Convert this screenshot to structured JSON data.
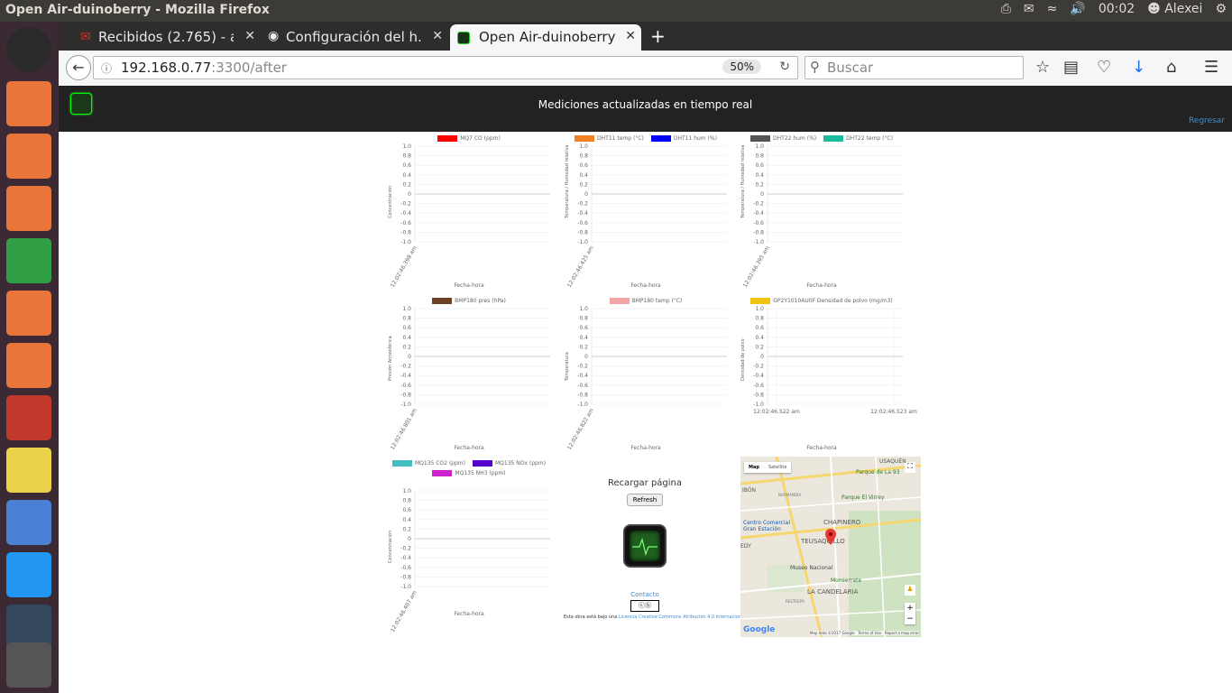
{
  "window": {
    "title": "Open Air-duinoberry - Mozilla Firefox"
  },
  "panel": {
    "time": "00:02",
    "user": "Alexei"
  },
  "tabs": [
    {
      "label": "Recibidos (2.765) - a...",
      "icon": "gmail-icon"
    },
    {
      "label": "Configuración del h...",
      "icon": "github-icon"
    },
    {
      "label": "Open Air-duinoberry",
      "icon": "duinoberry-icon"
    }
  ],
  "urlbar": {
    "host": "192.168.0.77",
    "path": ":3300/after",
    "zoom": "50%"
  },
  "searchbar": {
    "placeholder": "Buscar"
  },
  "app": {
    "header_title": "Mediciones actualizadas en tiempo real",
    "back_link": "Regresar"
  },
  "chart_data": [
    {
      "type": "line",
      "series": [
        {
          "name": "MQ7 CO (ppm)",
          "color": "#ff0000",
          "values": []
        }
      ],
      "xlabel": "Fecha-hora",
      "ylabel": "Concentración",
      "ylim": [
        -1,
        1
      ],
      "yticks": [
        "1.0",
        "0.8",
        "0.6",
        "0.4",
        "0.2",
        "0",
        "-0.2",
        "-0.4",
        "-0.6",
        "-0.8",
        "-1.0"
      ],
      "x": [
        "12:02:46.398 am"
      ]
    },
    {
      "type": "line",
      "series": [
        {
          "name": "DHT11 temp (°C)",
          "color": "#f48024",
          "values": []
        },
        {
          "name": "DHT11 hum (%)",
          "color": "#0000ff",
          "values": []
        }
      ],
      "xlabel": "Fecha-hora",
      "ylabel": "Temperatura / Humedad relativa",
      "ylim": [
        -1,
        1
      ],
      "yticks": [
        "1.0",
        "0.8",
        "0.6",
        "0.4",
        "0.2",
        "0",
        "-0.2",
        "-0.4",
        "-0.6",
        "-0.8",
        "-1.0"
      ],
      "x": [
        "12:02:46.425 am"
      ]
    },
    {
      "type": "line",
      "series": [
        {
          "name": "DHT22 hum (%)",
          "color": "#555555",
          "values": []
        },
        {
          "name": "DHT22 temp (°C)",
          "color": "#1abc9c",
          "values": []
        }
      ],
      "xlabel": "Fecha-hora",
      "ylabel": "Temperatura / Humedad relativa",
      "ylim": [
        -1,
        1
      ],
      "yticks": [
        "1.0",
        "0.8",
        "0.6",
        "0.4",
        "0.2",
        "0",
        "-0.2",
        "-0.4",
        "-0.6",
        "-0.8",
        "-1.0"
      ],
      "x": [
        "12:02:46.395 am"
      ]
    },
    {
      "type": "line",
      "series": [
        {
          "name": "BMP180 pres (hPa)",
          "color": "#6b4226",
          "values": []
        }
      ],
      "xlabel": "Fecha-hora",
      "ylabel": "Presión Atmosférica",
      "ylim": [
        -1,
        1
      ],
      "yticks": [
        "1.0",
        "0.8",
        "0.6",
        "0.4",
        "0.2",
        "0",
        "-0.2",
        "-0.4",
        "-0.6",
        "-0.8",
        "-1.0"
      ],
      "x": [
        "12:02:46.801 am"
      ]
    },
    {
      "type": "line",
      "series": [
        {
          "name": "BMP180 temp (°C)",
          "color": "#f4a4a4",
          "values": []
        }
      ],
      "xlabel": "Fecha-hora",
      "ylabel": "Temperatura",
      "ylim": [
        -1,
        1
      ],
      "yticks": [
        "1.0",
        "0.8",
        "0.6",
        "0.4",
        "0.2",
        "0",
        "-0.2",
        "-0.4",
        "-0.6",
        "-0.8",
        "-1.0"
      ],
      "x": [
        "12:02:46.822 am"
      ]
    },
    {
      "type": "line",
      "series": [
        {
          "name": "GP2Y1010AU0F Densidad de polvo (mg/m3)",
          "color": "#f1c40f",
          "values": []
        }
      ],
      "xlabel": "Fecha-hora",
      "ylabel": "Densidad de polvo",
      "ylim": [
        -1,
        1
      ],
      "yticks": [
        "1.0",
        "0.8",
        "0.6",
        "0.4",
        "0.2",
        "0",
        "-0.2",
        "-0.4",
        "-0.6",
        "-0.8",
        "-1.0"
      ],
      "x": [
        "12:02:46.522 am",
        "12:02:46.523 am"
      ]
    },
    {
      "type": "line",
      "series": [
        {
          "name": "MQ135 CO2 (ppm)",
          "color": "#3fbfbf",
          "values": []
        },
        {
          "name": "MQ135 NOx (ppm)",
          "color": "#5500cc",
          "values": []
        },
        {
          "name": "MQ135 NH3 (ppm)",
          "color": "#cc22cc",
          "values": []
        }
      ],
      "xlabel": "Fecha-hora",
      "ylabel": "Concentración",
      "ylim": [
        -1,
        1
      ],
      "yticks": [
        "1.0",
        "0.8",
        "0.6",
        "0.4",
        "0.2",
        "0",
        "-0.2",
        "-0.4",
        "-0.6",
        "-0.8",
        "-1.0"
      ],
      "x": [
        "12:02:46.407 am"
      ]
    }
  ],
  "refresh": {
    "heading": "Recargar página",
    "button": "Refresh",
    "contact": "Contacto",
    "license_prefix": "Esta obra está bajo una ",
    "license_link": "Licencia Creative Commons Atribución 4.0 Internacional",
    "license_suffix": "."
  },
  "map": {
    "type_map": "Map",
    "type_satellite": "Satellite",
    "labels": [
      "Parque de La 93",
      "Parque El Virrey",
      "CHAPINERO",
      "Centro Comercial Gran Estación",
      "TEUSAQUILLO",
      "Museo Nacional",
      "Monserrate",
      "LA CANDELARIA",
      "USAQUÉN",
      "NORMANDÍA",
      "RESTREPO",
      "IBÓN",
      "EDY"
    ],
    "footer_data": "Map data ©2017 Google",
    "footer_terms": "Terms of Use",
    "footer_report": "Report a map error",
    "brand": "Google",
    "zoom_in": "+",
    "zoom_out": "−"
  },
  "colors": {
    "accent": "#428bca",
    "header_bg": "#222222",
    "launcher_bg": "#3b2a34"
  }
}
